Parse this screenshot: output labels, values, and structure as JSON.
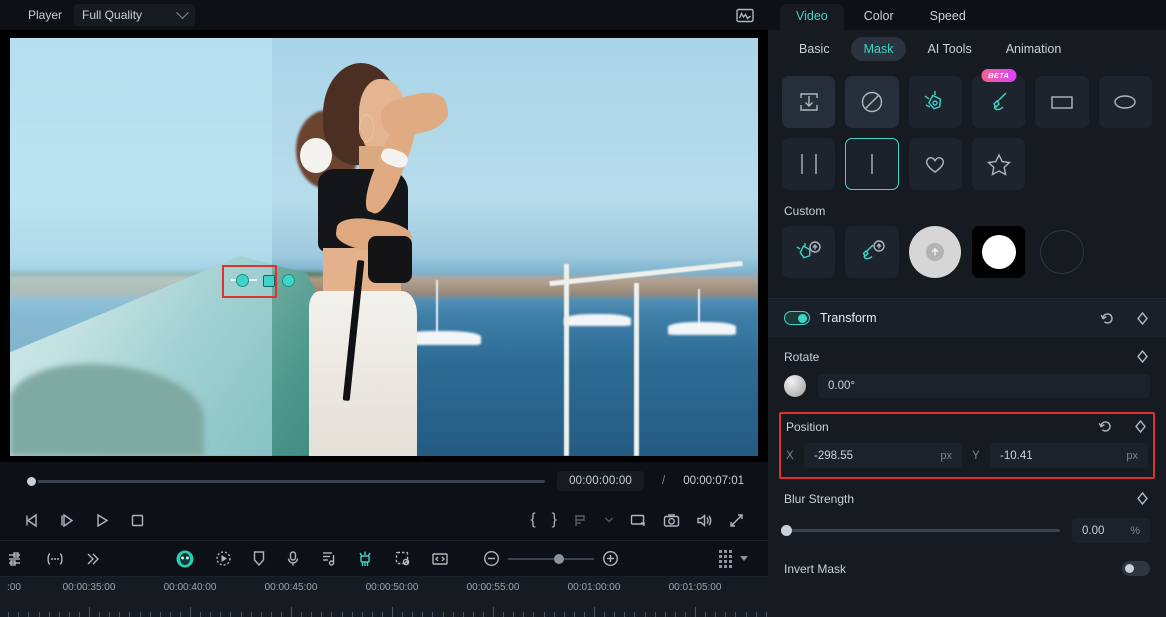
{
  "player": {
    "label": "Player",
    "quality": "Full Quality",
    "quality_icon": "chevron-down-icon",
    "scope_icon": "waveform-scope-icon"
  },
  "transport": {
    "current_time": "00:00:00:00",
    "separator": "/",
    "total_time": "00:00:07:01",
    "buttons": [
      {
        "name": "prev-frame-button",
        "icon": "step-backward-icon"
      },
      {
        "name": "next-frame-button",
        "icon": "step-forward-icon"
      },
      {
        "name": "play-button",
        "icon": "play-icon"
      },
      {
        "name": "stop-button",
        "icon": "stop-icon"
      }
    ],
    "right_buttons": [
      {
        "name": "mark-in-button",
        "label": "{"
      },
      {
        "name": "mark-out-button",
        "label": "}"
      },
      {
        "name": "markers-button",
        "icon": "marker-icon"
      },
      {
        "name": "markers-dropdown",
        "icon": "chevron-down-icon"
      },
      {
        "name": "display-mode-button",
        "icon": "monitor-icon"
      },
      {
        "name": "snapshot-button",
        "icon": "camera-icon"
      },
      {
        "name": "volume-button",
        "icon": "speaker-icon"
      },
      {
        "name": "fullscreen-button",
        "icon": "expand-icon"
      }
    ]
  },
  "mask_overlay": {
    "handles": [
      "mask-handle-left-dot",
      "mask-handle-center-square",
      "mask-handle-right-dot"
    ],
    "annotation": "red-highlight-box"
  },
  "timeline_toolbar": {
    "left": [
      {
        "name": "mixer-button",
        "icon": "mixer-icon"
      },
      {
        "name": "more-button",
        "icon": "ellipsis-box-icon"
      },
      {
        "name": "expand-button",
        "icon": "double-chevron-right-icon"
      }
    ],
    "center": [
      {
        "name": "auto-reframe-button",
        "icon": "mask-ball-icon",
        "active": true
      },
      {
        "name": "keyframe-button",
        "icon": "keyframe-dotted-icon"
      },
      {
        "name": "marker-button",
        "icon": "shield-marker-icon"
      },
      {
        "name": "voiceover-button",
        "icon": "microphone-icon"
      },
      {
        "name": "beat-detect-button",
        "icon": "music-note-icon"
      },
      {
        "name": "green-screen-button",
        "icon": "chroma-key-icon",
        "active": true
      },
      {
        "name": "crop-button",
        "icon": "crop-icon"
      },
      {
        "name": "fit-button",
        "icon": "fit-width-icon"
      }
    ],
    "zoom": {
      "out_icon": "zoom-out-icon",
      "in_icon": "zoom-in-icon"
    },
    "right": [
      {
        "name": "track-options-button",
        "icon": "dots-grid-icon"
      },
      {
        "name": "track-options-dropdown",
        "icon": "triangle-down-icon"
      }
    ]
  },
  "ruler": {
    "labels": [
      ":00",
      "00:00:35:00",
      "00:00:40:00",
      "00:00:45:00",
      "00:00:50:00",
      "00:00:55:00",
      "00:01:00:00",
      "00:01:05:00"
    ]
  },
  "right_panel": {
    "top_tabs": [
      {
        "label": "Video",
        "active": true
      },
      {
        "label": "Color",
        "active": false
      },
      {
        "label": "Speed",
        "active": false
      }
    ],
    "sub_tabs": [
      {
        "label": "Basic",
        "active": false
      },
      {
        "label": "Mask",
        "active": true
      },
      {
        "label": "AI Tools",
        "active": false
      },
      {
        "label": "Animation",
        "active": false
      }
    ],
    "shapes": [
      {
        "name": "mask-import-icon",
        "selected": false,
        "beta": false
      },
      {
        "name": "mask-none-icon",
        "selected": false,
        "beta": false
      },
      {
        "name": "mask-pen-icon",
        "selected": false,
        "beta": false
      },
      {
        "name": "mask-brush-icon",
        "selected": false,
        "beta": true,
        "beta_label": "BETA"
      },
      {
        "name": "mask-rectangle-icon",
        "selected": false,
        "beta": false
      },
      {
        "name": "mask-ellipse-icon",
        "selected": false,
        "beta": false
      },
      {
        "name": "mask-double-line-icon",
        "selected": false,
        "beta": false
      },
      {
        "name": "mask-single-line-icon",
        "selected": true,
        "beta": false
      },
      {
        "name": "mask-heart-icon",
        "selected": false,
        "beta": false
      },
      {
        "name": "mask-star-icon",
        "selected": false,
        "beta": false
      }
    ],
    "custom": {
      "title": "Custom",
      "items": [
        {
          "name": "custom-pen-upload-icon"
        },
        {
          "name": "custom-brush-upload-icon"
        },
        {
          "name": "custom-upload-ball-icon"
        },
        {
          "name": "custom-bw-circle-preset"
        },
        {
          "name": "custom-empty-slot"
        }
      ]
    },
    "transform": {
      "label": "Transform",
      "enabled": true,
      "reset_icon": "reset-icon",
      "keyframe_icon": "keyframe-diamond-icon"
    },
    "rotate": {
      "label": "Rotate",
      "value": "0.00°",
      "keyframe_icon": "keyframe-diamond-icon"
    },
    "position": {
      "label": "Position",
      "highlighted": true,
      "reset_icon": "reset-icon",
      "keyframe_icon": "keyframe-diamond-icon",
      "x_label": "X",
      "x_value": "-298.55",
      "x_unit": "px",
      "y_label": "Y",
      "y_value": "-10.41",
      "y_unit": "px"
    },
    "blur": {
      "label": "Blur Strength",
      "value": "0.00",
      "unit": "%",
      "keyframe_icon": "keyframe-diamond-icon",
      "slider_percent": 0
    },
    "invert": {
      "label": "Invert Mask",
      "enabled": false
    }
  },
  "colors": {
    "accent": "#3fd4c8",
    "annotation": "#e03131",
    "panel_bg": "#161b22",
    "dark_bg": "#0d1117",
    "beta_badge": "#e040fb"
  }
}
